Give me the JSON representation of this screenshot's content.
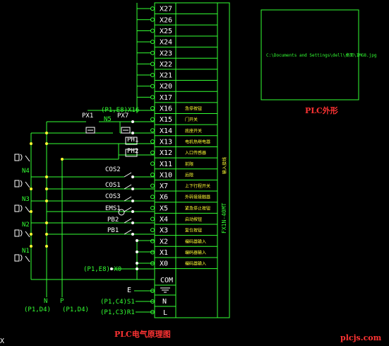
{
  "diagram": {
    "title": "PLC电气原理图",
    "outline_caption": "PLC外形",
    "outline_image_path": "C:\\Documents and Settings\\dell\\桌面\\IMG8.jpg",
    "plc_model": "FX1N-40MT",
    "plc_model_sub": "输入接线",
    "watermark": "plcjs.com",
    "cursor_glyph": "X"
  },
  "spare_inputs": [
    "X27",
    "X26",
    "X25",
    "X24",
    "X23",
    "X22",
    "X21",
    "X20",
    "X17"
  ],
  "inputs": [
    {
      "terminal": "X16",
      "function": "急停按钮"
    },
    {
      "terminal": "X15",
      "function": "门开关"
    },
    {
      "terminal": "X14",
      "function": "底座开关"
    },
    {
      "terminal": "X13",
      "function": "电机热继电器"
    },
    {
      "terminal": "X12",
      "function": "入口传感器"
    },
    {
      "terminal": "X11",
      "function": "前限"
    },
    {
      "terminal": "X10",
      "function": "后限"
    },
    {
      "terminal": "X7",
      "function": "上下行程开关"
    },
    {
      "terminal": "X6",
      "function": "外转接接触器"
    },
    {
      "terminal": "X5",
      "function": "紧急停止按钮"
    },
    {
      "terminal": "X4",
      "function": "启动按钮"
    },
    {
      "terminal": "X3",
      "function": "复位按钮"
    },
    {
      "terminal": "X2",
      "function": "编码器输入"
    },
    {
      "terminal": "X1",
      "function": "编码器输入"
    },
    {
      "terminal": "X0",
      "function": "编码器输入"
    }
  ],
  "power_terminals": [
    "COM",
    "E",
    "N",
    "L"
  ],
  "devices": {
    "px1": "PX1",
    "px7": "PX7",
    "n5": "N5",
    "ph1": "PH1",
    "ph2": "PH2",
    "cos2": "COS2",
    "cos1": "COS1",
    "cos3": "COS3",
    "ems1": "EMS1",
    "pb2": "PB2",
    "pb1": "PB1"
  },
  "left_labels": [
    "N4",
    "N3",
    "N2",
    "N1"
  ],
  "cross_refs": {
    "x16_ref": "(P1,E8)",
    "x16_tag": "X16",
    "x0_ref": "(P1,E8) X0",
    "n_ref": "(P1,C4)S1",
    "l_ref": "(P1,C3)R1",
    "bus_n": "N",
    "bus_p": "P",
    "bus_n_ref": "(P1,D4)",
    "bus_p_ref": "(P1,D4)"
  }
}
